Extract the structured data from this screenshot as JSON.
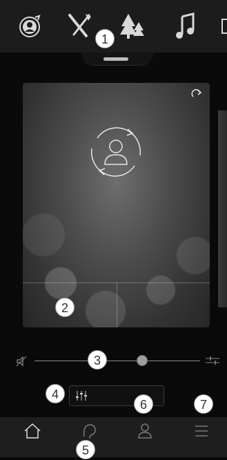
{
  "top_tabs": [
    {
      "icon": "profile-sync-icon"
    },
    {
      "icon": "tools-icon"
    },
    {
      "icon": "trees-icon"
    },
    {
      "icon": "music-note-icon"
    },
    {
      "icon": "partial-icon"
    }
  ],
  "panel": {
    "icon": "person-cycle-icon",
    "corner_icon": "share-icon"
  },
  "volume": {
    "mute_icon": "mute-icon",
    "settings_icon": "sliders-icon",
    "level": 0.65
  },
  "equalizer": {
    "icon": "equalizer-icon"
  },
  "markers": [
    "1",
    "2",
    "3",
    "4",
    "5",
    "6",
    "7"
  ],
  "bottom_nav": [
    {
      "icon": "home-icon"
    },
    {
      "icon": "ear-icon"
    },
    {
      "icon": "person-icon"
    },
    {
      "icon": "menu-icon"
    }
  ],
  "colors": {
    "accent": "#ffffff",
    "background": "#0a0a0a",
    "bar": "#1c1c1c"
  }
}
